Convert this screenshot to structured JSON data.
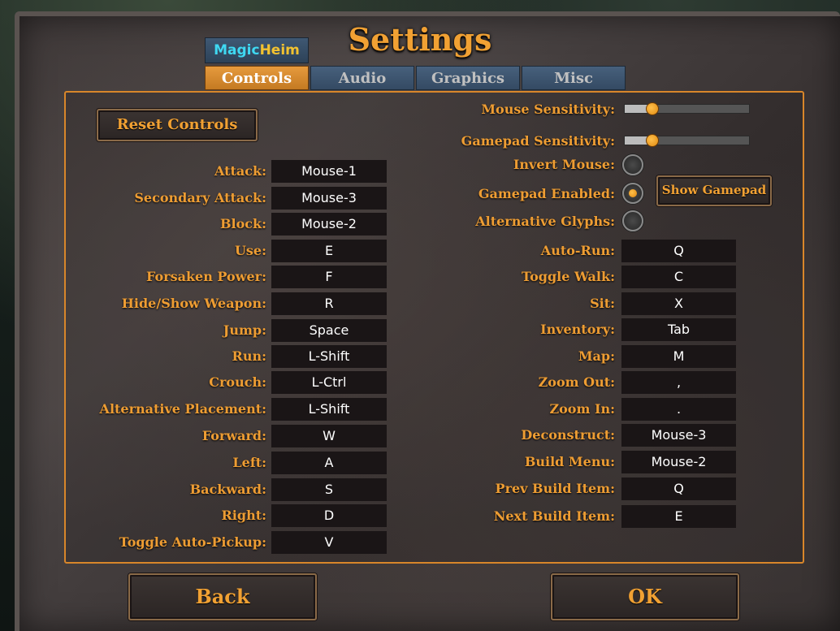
{
  "title": "Settings",
  "badge": {
    "part1": "Magic",
    "part2": "Heim"
  },
  "tabs": [
    {
      "label": "Controls",
      "active": true
    },
    {
      "label": "Audio",
      "active": false
    },
    {
      "label": "Graphics",
      "active": false
    },
    {
      "label": "Misc",
      "active": false
    }
  ],
  "reset_button": "Reset Controls",
  "mouse_sensitivity": {
    "label": "Mouse Sensitivity:",
    "value": 0.22
  },
  "gamepad_sensitivity": {
    "label": "Gamepad Sensitivity:",
    "value": 0.22
  },
  "toggles": [
    {
      "label": "Invert Mouse:",
      "checked": false
    },
    {
      "label": "Gamepad Enabled:",
      "checked": true
    },
    {
      "label": "Alternative Glyphs:",
      "checked": false
    }
  ],
  "show_gamepad_button": "Show Gamepad",
  "left_bindings": [
    {
      "label": "Attack:",
      "key": "Mouse-1"
    },
    {
      "label": "Secondary Attack:",
      "key": "Mouse-3"
    },
    {
      "label": "Block:",
      "key": "Mouse-2"
    },
    {
      "label": "Use:",
      "key": "E"
    },
    {
      "label": "Forsaken Power:",
      "key": "F"
    },
    {
      "label": "Hide/Show Weapon:",
      "key": "R"
    },
    {
      "label": "Jump:",
      "key": "Space"
    },
    {
      "label": "Run:",
      "key": "L-Shift"
    },
    {
      "label": "Crouch:",
      "key": "L-Ctrl"
    },
    {
      "label": "Alternative Placement:",
      "key": "L-Shift"
    },
    {
      "label": "Forward:",
      "key": "W"
    },
    {
      "label": "Left:",
      "key": "A"
    },
    {
      "label": "Backward:",
      "key": "S"
    },
    {
      "label": "Right:",
      "key": "D"
    },
    {
      "label": "Toggle Auto-Pickup:",
      "key": "V"
    }
  ],
  "right_bindings": [
    {
      "label": "Auto-Run:",
      "key": "Q"
    },
    {
      "label": "Toggle Walk:",
      "key": "C"
    },
    {
      "label": "Sit:",
      "key": "X"
    },
    {
      "label": "Inventory:",
      "key": "Tab"
    },
    {
      "label": "Map:",
      "key": "M"
    },
    {
      "label": "Zoom Out:",
      "key": ","
    },
    {
      "label": "Zoom In:",
      "key": "."
    },
    {
      "label": "Deconstruct:",
      "key": "Mouse-3"
    },
    {
      "label": "Build Menu:",
      "key": "Mouse-2"
    },
    {
      "label": "Prev Build Item:",
      "key": "Q"
    },
    {
      "label": "Next Build Item:",
      "key": "E"
    }
  ],
  "back_button": "Back",
  "ok_button": "OK",
  "colors": {
    "accent": "#f1a133",
    "tab_active": "#d98a2e",
    "tab_inactive": "#3f5873"
  }
}
